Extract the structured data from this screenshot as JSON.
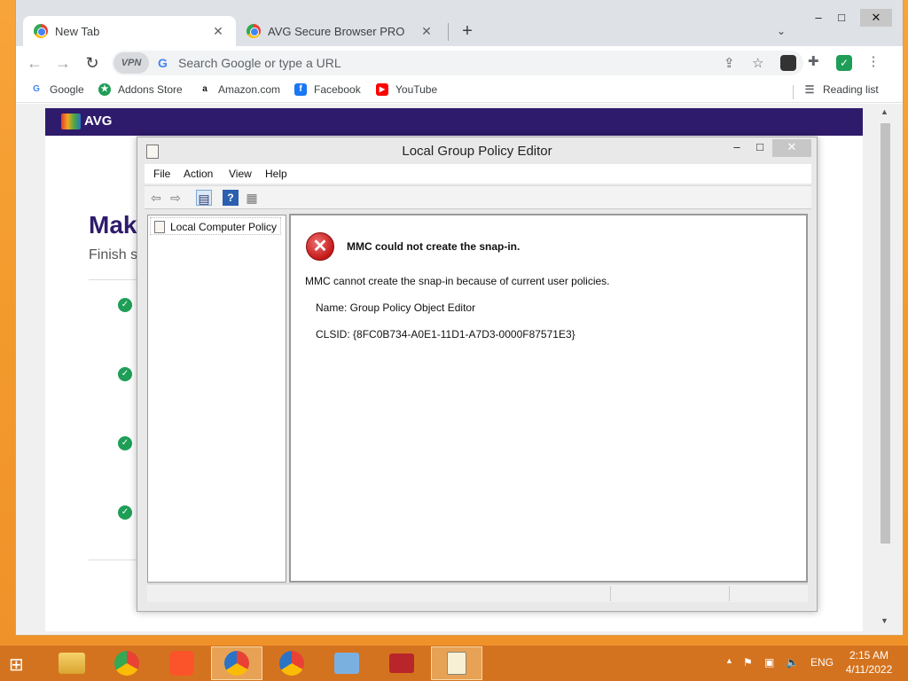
{
  "browser": {
    "tabs": [
      {
        "label": "New Tab",
        "close": "✕"
      },
      {
        "label": "AVG Secure Browser PRO",
        "close": "✕"
      }
    ],
    "new_tab": "+",
    "tab_search": "⌄",
    "window_controls": {
      "minimize": "–",
      "maximize": "□",
      "close": "✕"
    },
    "nav": {
      "back": "←",
      "forward": "→",
      "reload": "↻"
    },
    "vpn_label": "VPN",
    "omnibox_placeholder": "Search Google or type a URL",
    "bookmarks": [
      "Google",
      "Addons Store",
      "Amazon.com",
      "Facebook",
      "YouTube"
    ],
    "reading_list": "Reading list"
  },
  "page": {
    "logo": "AVG",
    "heading": "Mak",
    "subheading": "Finish s"
  },
  "mmc": {
    "title": "Local Group Policy Editor",
    "controls": {
      "minimize": "–",
      "maximize": "□",
      "close": "✕"
    },
    "menu": [
      "File",
      "Action",
      "View",
      "Help"
    ],
    "tree_root": "Local Computer Policy",
    "error": {
      "title": "MMC could not create the snap-in.",
      "message": "MMC cannot create the snap-in because of current user policies.",
      "name": "Name: Group Policy Object Editor",
      "clsid": "CLSID: {8FC0B734-A0E1-11D1-A7D3-0000F87571E3}"
    }
  },
  "taskbar": {
    "language": "ENG",
    "time": "2:15 AM",
    "date": "4/11/2022"
  }
}
